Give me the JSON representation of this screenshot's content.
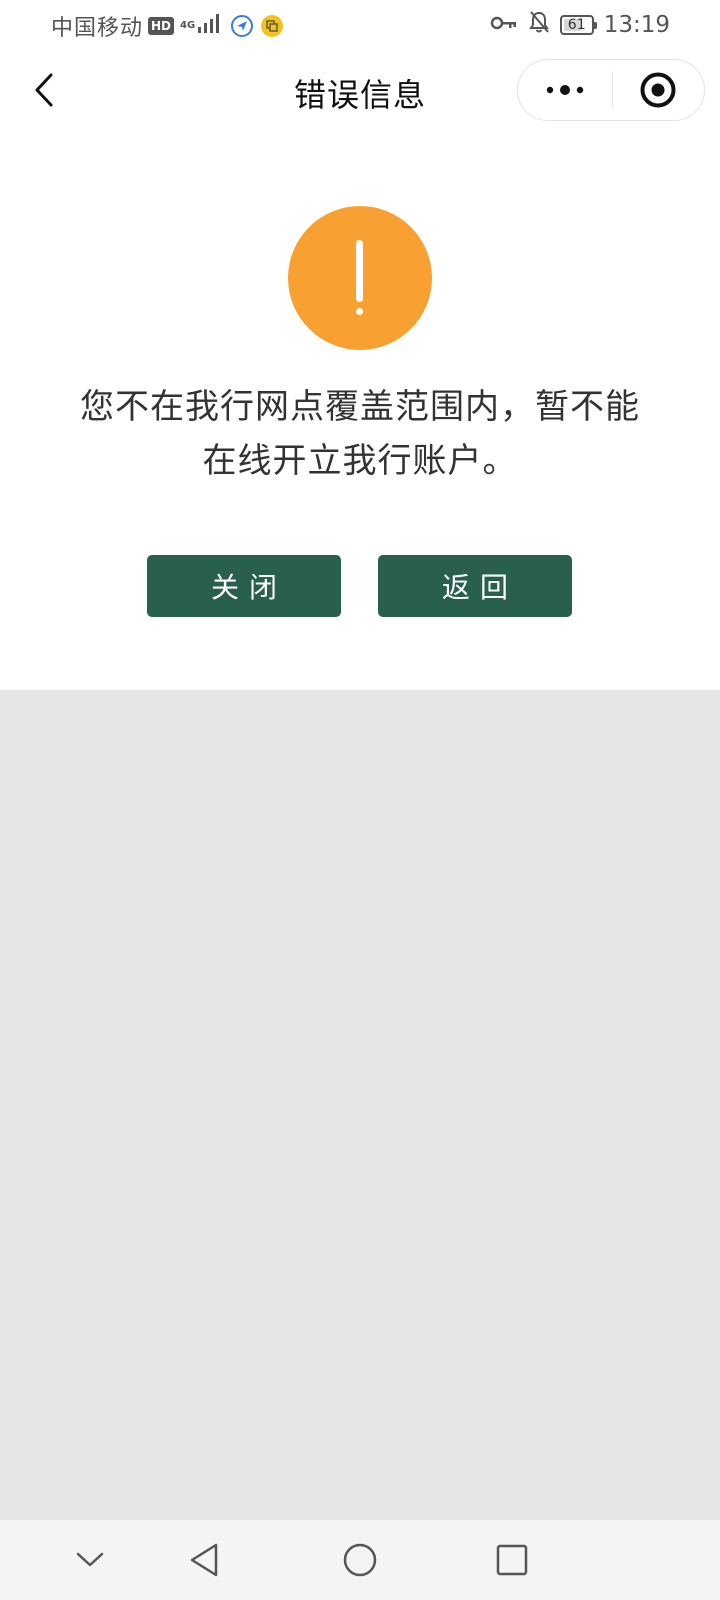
{
  "status_bar": {
    "carrier": "中国移动",
    "hd": "HD",
    "network": "4G",
    "battery": "61",
    "time": "13:19"
  },
  "nav": {
    "title": "错误信息"
  },
  "error": {
    "message_line1": "您不在我行网点覆盖范围内，暂不能",
    "message_line2": "在线开立我行账户。",
    "icon_color": "#f8a132"
  },
  "buttons": {
    "close_label": "关闭",
    "back_label": "返回",
    "button_color": "#28604d"
  },
  "progress": {
    "battery_level_percent": 61
  }
}
